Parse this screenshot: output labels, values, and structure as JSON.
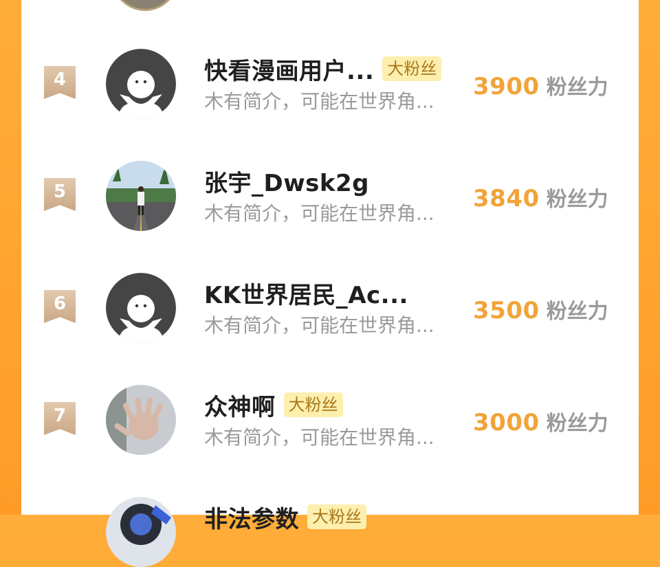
{
  "list": {
    "rows": [
      {
        "rank": "4",
        "name": "快看漫画用户...",
        "tag": "大粉丝",
        "bio": "木有简介，可能在世界角...",
        "score": "3900",
        "score_unit": "粉丝力",
        "avatar": "default-avatar"
      },
      {
        "rank": "5",
        "name": "张宇_Dwsk2g",
        "tag": "",
        "bio": "木有简介，可能在世界角...",
        "score": "3840",
        "score_unit": "粉丝力",
        "avatar": "photo-avatar"
      },
      {
        "rank": "6",
        "name": "KK世界居民_Ac...",
        "tag": "",
        "bio": "木有简介，可能在世界角...",
        "score": "3500",
        "score_unit": "粉丝力",
        "avatar": "default-avatar"
      },
      {
        "rank": "7",
        "name": "众神啊",
        "tag": "大粉丝",
        "bio": "木有简介，可能在世界角...",
        "score": "3000",
        "score_unit": "粉丝力",
        "avatar": "photo-avatar"
      },
      {
        "rank": "",
        "name": "非法参数",
        "tag": "大粉丝",
        "bio": "",
        "score": "",
        "score_unit": "",
        "avatar": "photo-avatar"
      }
    ]
  },
  "colors": {
    "background_orange": "#ff9c28",
    "rank_badge": "#d4b594",
    "score": "#f2a33a",
    "tag_bg": "#fdefae",
    "tag_text": "#a9781a",
    "name": "#1f1f1f",
    "muted": "#9a9a9a"
  }
}
